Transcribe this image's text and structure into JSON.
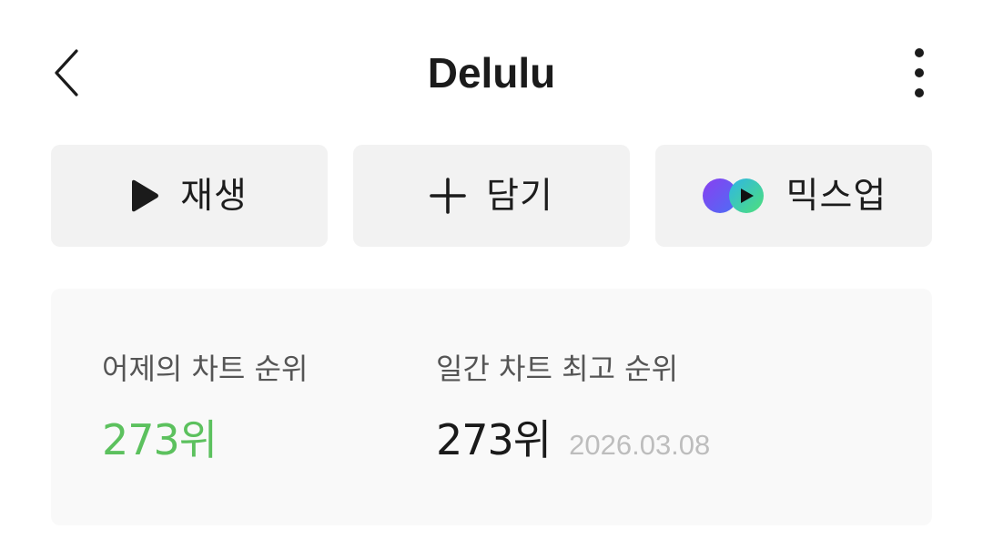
{
  "header": {
    "title": "Delulu"
  },
  "actions": {
    "play_label": "재생",
    "add_label": "담기",
    "mixup_label": "믹스업"
  },
  "chart_info": {
    "yesterday_label": "어제의 차트 순위",
    "yesterday_rank": "273위",
    "best_label": "일간 차트 최고 순위",
    "best_rank": "273위",
    "best_date": "2026.03.08"
  },
  "colors": {
    "rank_green": "#5cc15e",
    "button_bg": "#f2f2f2",
    "card_bg": "#f9f9f9"
  },
  "icons": {
    "back": "chevron-left-icon",
    "more": "more-vertical-icon",
    "play": "play-icon",
    "add": "plus-icon",
    "mixup": "mixup-icon"
  }
}
